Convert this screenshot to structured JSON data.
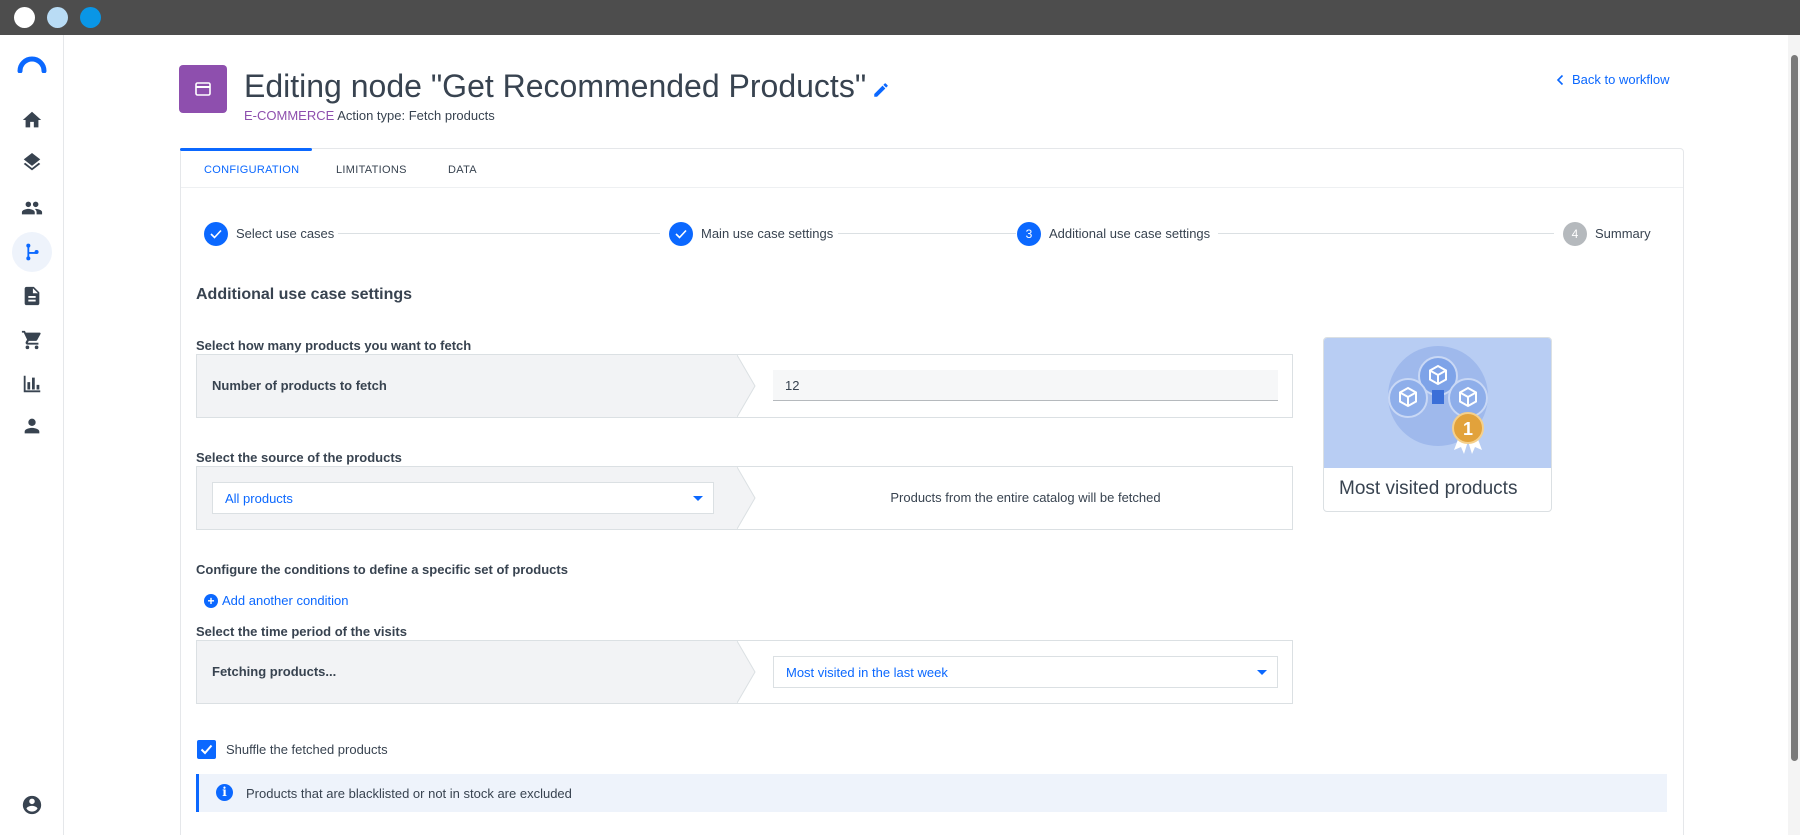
{
  "window": {
    "dots": [
      "#ffffff",
      "#b9dcf5",
      "#0a96e6"
    ]
  },
  "sidebar": {
    "items": [
      {
        "name": "home-icon"
      },
      {
        "name": "layers-icon"
      },
      {
        "name": "people-icon"
      },
      {
        "name": "workflow-icon",
        "active": true
      },
      {
        "name": "document-icon"
      },
      {
        "name": "cart-icon"
      },
      {
        "name": "chart-icon"
      },
      {
        "name": "person-icon"
      },
      {
        "name": "account-icon"
      }
    ]
  },
  "header": {
    "title": "Editing node \"Get Recommended Products\"",
    "category": "E-COMMERCE",
    "action_type": "Action type: Fetch products",
    "back_label": "Back to workflow",
    "badge_color": "#8e4fae"
  },
  "tabs": [
    {
      "label": "CONFIGURATION",
      "active": true
    },
    {
      "label": "LIMITATIONS",
      "active": false
    },
    {
      "label": "DATA",
      "active": false
    }
  ],
  "stepper": {
    "steps": [
      {
        "label": "Select use cases",
        "state": "done"
      },
      {
        "label": "Main use case settings",
        "state": "done"
      },
      {
        "label": "Additional use case settings",
        "state": "current",
        "number": "3"
      },
      {
        "label": "Summary",
        "state": "pending",
        "number": "4"
      }
    ]
  },
  "form": {
    "section_title": "Additional use case settings",
    "products_count": {
      "heading": "Select how many products you want to fetch",
      "label": "Number of products to fetch",
      "value": "12"
    },
    "source": {
      "heading": "Select the source of the products",
      "selected": "All products",
      "description": "Products from the entire catalog will be fetched"
    },
    "conditions": {
      "heading": "Configure the conditions to define a specific set of products",
      "add_label": "Add another condition"
    },
    "time_period": {
      "heading": "Select the time period of the visits",
      "label": "Fetching products...",
      "selected": "Most visited in the last week"
    },
    "shuffle": {
      "label": "Shuffle the fetched products",
      "checked": true
    },
    "info": "Products that are blacklisted or not in stock are excluded"
  },
  "preview": {
    "title": "Most visited products",
    "badge_number": "1"
  }
}
